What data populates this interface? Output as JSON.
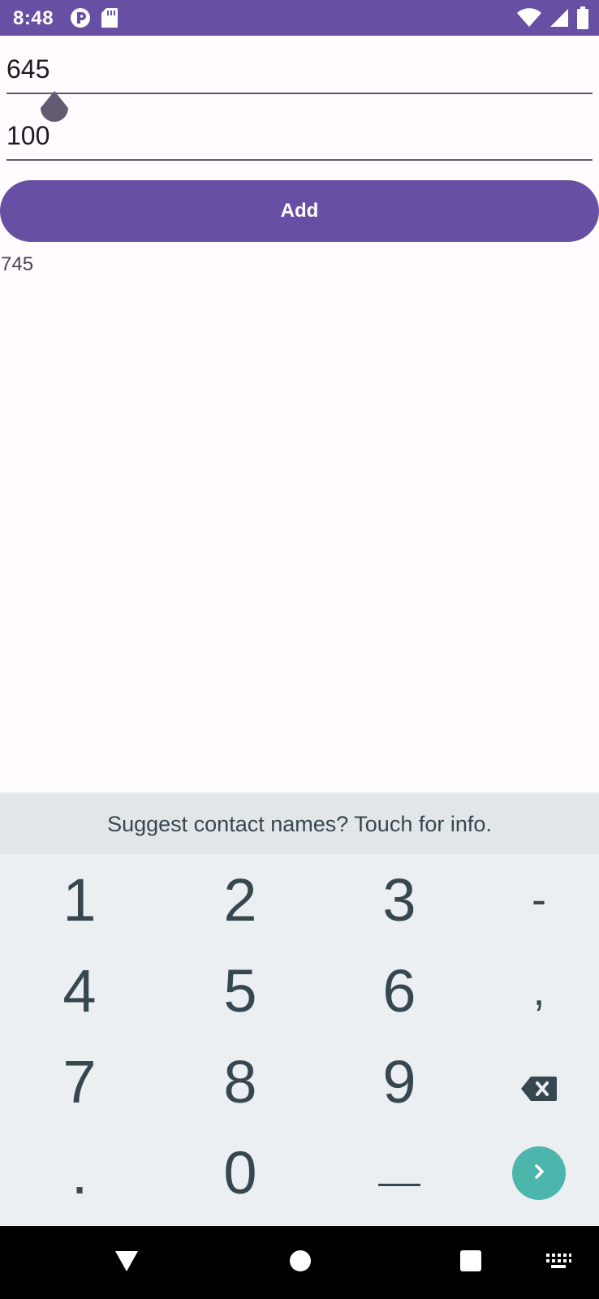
{
  "status_bar": {
    "time": "8:48",
    "left_icons": [
      "play-protect-icon",
      "sd-card-icon"
    ],
    "right_icons": [
      "wifi-icon",
      "signal-icon",
      "battery-icon"
    ]
  },
  "form": {
    "first_value": "645",
    "second_value": "100",
    "add_label": "Add",
    "result": "745"
  },
  "keyboard": {
    "suggestion": "Suggest contact names? Touch for info.",
    "rows": [
      [
        "1",
        "2",
        "3",
        "-"
      ],
      [
        "4",
        "5",
        "6",
        ","
      ],
      [
        "7",
        "8",
        "9",
        "backspace-icon"
      ],
      [
        ".",
        "0",
        "space-icon",
        "enter-icon"
      ]
    ]
  },
  "nav_bar": {
    "icons": [
      "back-icon",
      "home-icon",
      "recents-icon",
      "keyboard-switch-icon"
    ]
  },
  "colors": {
    "primary": "#6750a4",
    "key_text": "#37474f",
    "enter": "#4db6ac"
  }
}
